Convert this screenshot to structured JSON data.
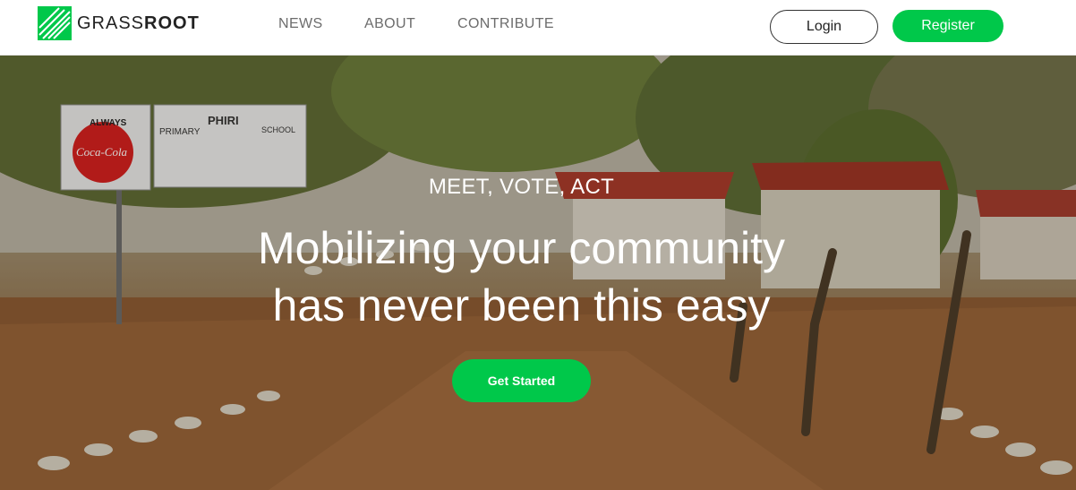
{
  "brand": {
    "name_light": "GRASS",
    "name_bold": "ROOT",
    "accent_color": "#00c84a"
  },
  "nav": {
    "links": [
      "NEWS",
      "ABOUT",
      "CONTRIBUTE"
    ],
    "login_label": "Login",
    "register_label": "Register"
  },
  "hero": {
    "eyebrow": "MEET, VOTE, ACT",
    "title_line1": "Mobilizing your community",
    "title_line2": "has never been this easy",
    "cta_label": "Get Started",
    "background_sign": {
      "top_text": "ALWAYS",
      "brand_text": "Coca-Cola",
      "school_words": [
        "PRIMARY",
        "PHIRI",
        "SCHOOL"
      ]
    }
  }
}
